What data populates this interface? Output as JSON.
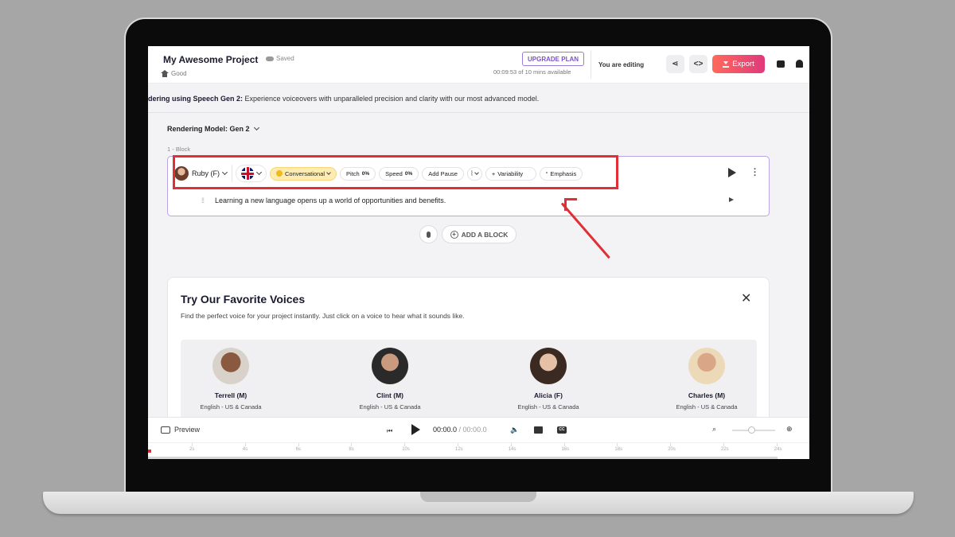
{
  "header": {
    "project_title": "My Awesome Project",
    "save_status": "Saved",
    "quality": "Good",
    "upgrade_label": "UPGRADE PLAN",
    "minutes_available": "00:09:53 of 10 mins available",
    "editing_status": "You are editing",
    "export_label": "Export"
  },
  "banner": {
    "bold": "dering using Speech Gen 2:",
    "text": " Experience voiceovers with unparalleled precision and clarity with our most advanced model."
  },
  "editor": {
    "rendering_model": "Rendering Model: Gen 2",
    "block_label": "1 -  Block",
    "voice_name": "Ruby (F)",
    "style_label": "Conversational",
    "pitch_label": "Pitch",
    "pitch_value": "0%",
    "speed_label": "Speed",
    "speed_value": "0%",
    "add_pause_label": "Add Pause",
    "variability_label": "Variability",
    "emphasis_label": "Emphasis",
    "block_text": "Learning a new language opens up a world of opportunities and benefits.",
    "add_block_label": "ADD A BLOCK"
  },
  "voices_panel": {
    "title": "Try Our Favorite Voices",
    "description": "Find the perfect voice for your project instantly. Just click on a voice to hear what it sounds like.",
    "voices": [
      {
        "name": "Terrell (M)",
        "language": "English - US & Canada"
      },
      {
        "name": "Clint (M)",
        "language": "English - US & Canada"
      },
      {
        "name": "Alicia (F)",
        "language": "English - US & Canada"
      },
      {
        "name": "Charles (M)",
        "language": "English - US & Canada"
      }
    ]
  },
  "player": {
    "preview_label": "Preview",
    "current_time": "00:00.0",
    "total_time": "/ 00:00.0"
  },
  "timeline": {
    "ticks": [
      "2s",
      "4s",
      "6s",
      "8s",
      "10s",
      "12s",
      "14s",
      "16s",
      "18s",
      "20s",
      "22s",
      "24s"
    ]
  },
  "colors": {
    "accent": "#7b52c9",
    "export_gradient_start": "#ff6a5b",
    "export_gradient_end": "#e0397c",
    "annotation": "#e02f36"
  }
}
